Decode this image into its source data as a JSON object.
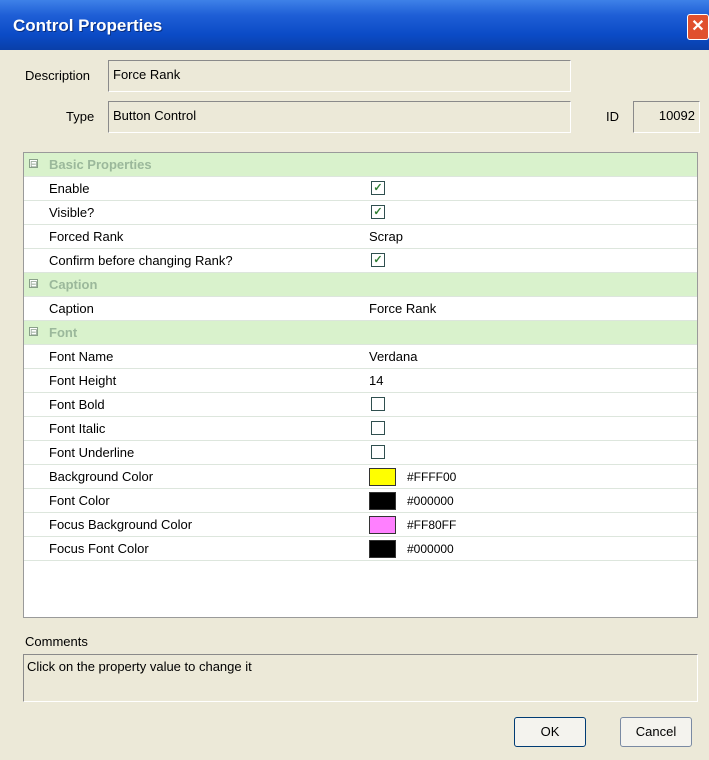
{
  "window": {
    "title": "Control Properties",
    "close_glyph": "✕"
  },
  "header": {
    "description_label": "Description",
    "description_value": "Force Rank",
    "type_label": "Type",
    "type_value": "Button Control",
    "id_label": "ID",
    "id_value": "10092"
  },
  "grid": {
    "categories": [
      {
        "label": "Basic Properties",
        "expander": "⊟"
      },
      {
        "label": "Caption",
        "expander": "⊟"
      },
      {
        "label": "Font",
        "expander": "⊟"
      }
    ],
    "properties": {
      "enable": {
        "name": "Enable",
        "checked": true
      },
      "visible": {
        "name": "Visible?",
        "checked": true
      },
      "forced_rank": {
        "name": "Forced Rank",
        "value": "Scrap"
      },
      "confirm": {
        "name": "Confirm before changing Rank?",
        "checked": true
      },
      "caption": {
        "name": "Caption",
        "value": "Force Rank"
      },
      "font_name": {
        "name": "Font Name",
        "value": "Verdana"
      },
      "font_height": {
        "name": "Font Height",
        "value": "14"
      },
      "font_bold": {
        "name": "Font Bold",
        "checked": false
      },
      "font_italic": {
        "name": "Font Italic",
        "checked": false
      },
      "font_underline": {
        "name": "Font Underline",
        "checked": false
      },
      "background_color": {
        "name": "Background Color",
        "hex": "#FFFF00"
      },
      "font_color": {
        "name": "Font Color",
        "hex": "#000000"
      },
      "focus_background_color": {
        "name": "Focus Background Color",
        "hex": "#FF80FF"
      },
      "focus_font_color": {
        "name": "Focus Font Color",
        "hex": "#000000"
      }
    },
    "check_glyph": "✓"
  },
  "comments": {
    "label": "Comments",
    "text": "Click on the property value to change it"
  },
  "buttons": {
    "ok": "OK",
    "cancel": "Cancel"
  }
}
